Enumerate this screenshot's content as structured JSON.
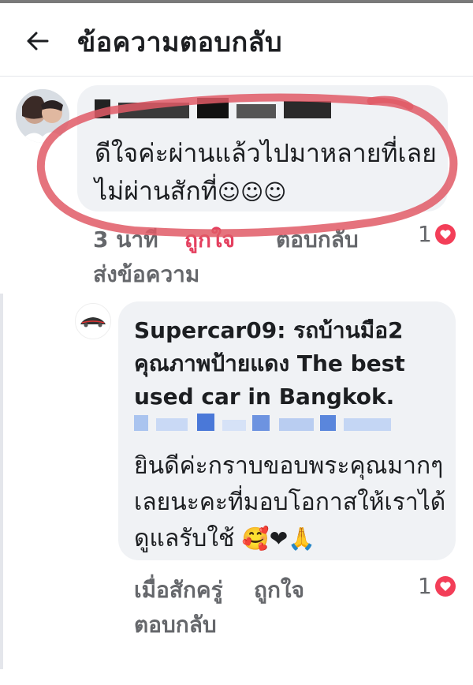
{
  "header": {
    "title": "ข้อความตอบกลับ",
    "back_icon": "arrow-left-icon"
  },
  "comment": {
    "text": "ดีใจค่ะผ่านแล้วไปมาหลายที่เลยไม่ผ่านสักที่",
    "emoji": "☺☺☺",
    "time": "3 นาที",
    "like_action": "ถูกใจ",
    "reply_action": "ตอบกลับ",
    "send_message": "ส่งข้อความ",
    "like_count": "1",
    "heart_icon": "heart-reaction-icon"
  },
  "reply": {
    "page_name": "Supercar09: รถบ้านมือ2 คุณภาพป้ายแดง The best used car in Bangkok.",
    "text": "ยินดีค่ะกราบขอบพระคุณมากๆเลยนะคะที่มอบโอกาสให้เราได้ดูแลรับใช้",
    "emoji": "🥰❤🙏",
    "time": "เมื่อสักครู่",
    "like_action": "ถูกใจ",
    "reply_action": "ตอบกลับ",
    "like_count": "1"
  },
  "colors": {
    "annotation_circle": "#e05a66",
    "like_active": "#e4405f",
    "bubble": "#f0f2f5",
    "meta": "#65676b"
  }
}
